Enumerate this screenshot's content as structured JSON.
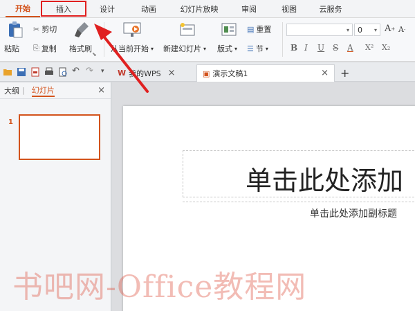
{
  "menu_tabs": [
    {
      "label": "开始"
    },
    {
      "label": "插入"
    },
    {
      "label": "设计"
    },
    {
      "label": "动画"
    },
    {
      "label": "幻灯片放映"
    },
    {
      "label": "审阅"
    },
    {
      "label": "视图"
    },
    {
      "label": "云服务"
    }
  ],
  "ribbon": {
    "paste": "粘贴",
    "cut": "剪切",
    "copy": "复制",
    "format_painter": "格式刷",
    "from_current": "从当前开始",
    "new_slide": "新建幻灯片",
    "layout": "版式",
    "section": "节",
    "reset": "重置",
    "font_size": "0",
    "format_buttons": [
      "B",
      "I",
      "U",
      "S",
      "A",
      "X²",
      "X₂"
    ]
  },
  "doc_tabs": {
    "wps_home": "我的WPS",
    "doc_name": "演示文稿1",
    "close": "×",
    "add": "+"
  },
  "left_panel": {
    "outline": "大纲",
    "slides": "幻灯片",
    "slide_number": "1",
    "close": "×"
  },
  "slide": {
    "title_placeholder": "单击此处添加",
    "subtitle_placeholder": "单击此处添加副标题"
  },
  "watermark": "书吧网-Office教程网",
  "colors": {
    "accent": "#d3531c",
    "highlight_box": "#e02020",
    "arrow": "#e02020"
  }
}
